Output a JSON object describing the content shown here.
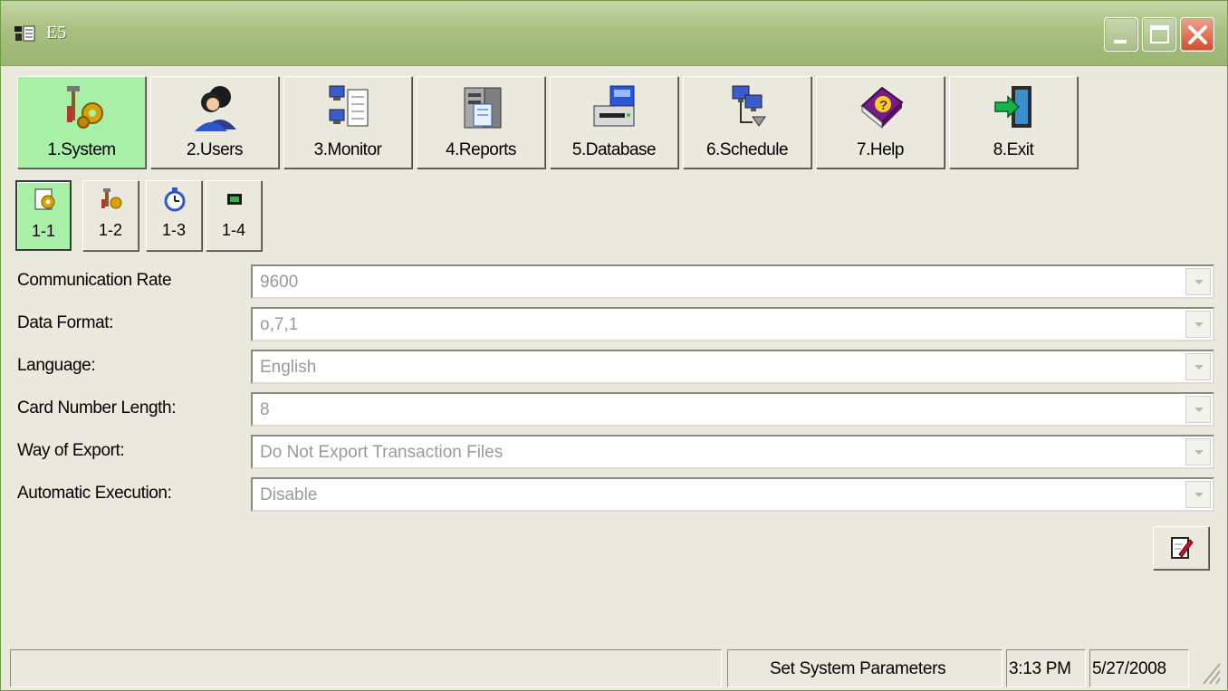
{
  "window": {
    "title": "E5"
  },
  "main_toolbar": [
    {
      "label": "1.System",
      "icon": "system-tools-icon",
      "active": true
    },
    {
      "label": "2.Users",
      "icon": "users-icon",
      "active": false
    },
    {
      "label": "3.Monitor",
      "icon": "monitor-icon",
      "active": false
    },
    {
      "label": "4.Reports",
      "icon": "reports-icon",
      "active": false
    },
    {
      "label": "5.Database",
      "icon": "database-icon",
      "active": false
    },
    {
      "label": "6.Schedule",
      "icon": "schedule-icon",
      "active": false
    },
    {
      "label": "7.Help",
      "icon": "help-book-icon",
      "active": false
    },
    {
      "label": "8.Exit",
      "icon": "exit-door-icon",
      "active": false
    }
  ],
  "sub_toolbar": [
    {
      "label": "1-1",
      "icon": "settings-icon",
      "active": true
    },
    {
      "label": "1-2",
      "icon": "tools-icon",
      "active": false
    },
    {
      "label": "1-3",
      "icon": "stopwatch-icon",
      "active": false
    },
    {
      "label": "1-4",
      "icon": "chip-icon",
      "active": false
    }
  ],
  "form": {
    "rows": [
      {
        "label": "Communication Rate",
        "value": "9600"
      },
      {
        "label": "Data Format:",
        "value": "o,7,1"
      },
      {
        "label": "Language:",
        "value": "English"
      },
      {
        "label": "Card Number Length:",
        "value": "8"
      },
      {
        "label": "Way of Export:",
        "value": "Do Not Export Transaction Files"
      },
      {
        "label": "Automatic Execution:",
        "value": "Disable"
      }
    ]
  },
  "status_bar": {
    "message": "Set System Parameters",
    "time": "3:13 PM",
    "date": "5/27/2008"
  },
  "colors": {
    "titlebar": "#9bb572",
    "active_button": "#a8f0a8",
    "window_bg": "#ebe9dd",
    "close_button": "#d6492a"
  }
}
